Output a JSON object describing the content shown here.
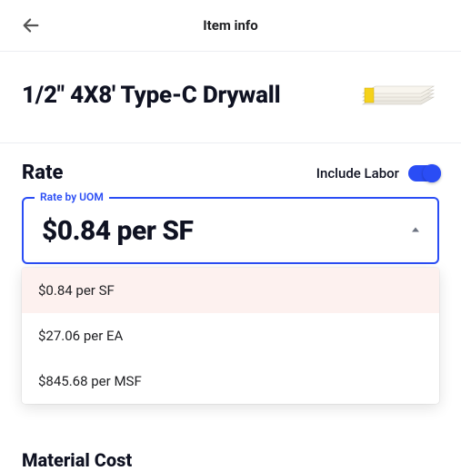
{
  "header": {
    "title": "Item info"
  },
  "item": {
    "name": "1/2\" 4X8' Type-C Drywall"
  },
  "rate": {
    "section_label": "Rate",
    "include_labor_label": "Include Labor",
    "include_labor_on": true,
    "field_legend": "Rate by UOM",
    "selected_value": "$0.84 per SF",
    "options": [
      "$0.84 per SF",
      "$27.06 per EA",
      "$845.68 per MSF"
    ]
  },
  "below": {
    "partial_heading": "Material Cost"
  }
}
